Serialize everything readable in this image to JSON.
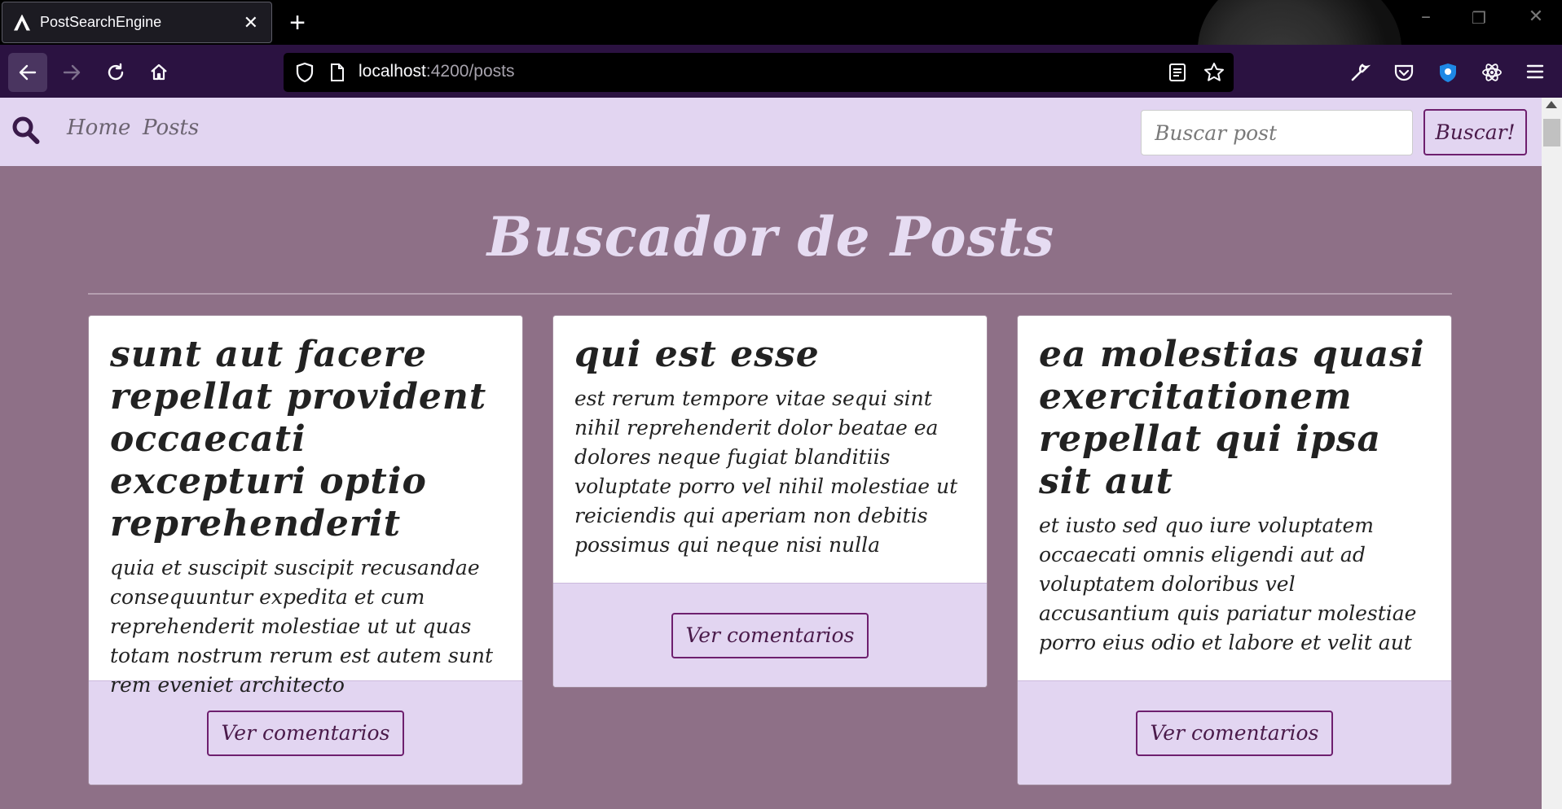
{
  "browser": {
    "tab_title": "PostSearchEngine",
    "tab_close": "✕",
    "new_tab": "+",
    "url_host": "localhost",
    "url_path": ":4200/posts",
    "win_min": "–",
    "win_restore": "❐",
    "win_close": "✕"
  },
  "navbar": {
    "links": [
      "Home",
      "Posts"
    ],
    "search_placeholder": "Buscar post",
    "search_button": "Buscar!"
  },
  "main": {
    "title": "Buscador de Posts",
    "posts": [
      {
        "title": "sunt aut facere repellat provident occaecati excepturi optio reprehenderit",
        "body": "quia et suscipit suscipit recusandae consequuntur expedita et cum reprehenderit molestiae ut ut quas totam nostrum rerum est autem sunt rem eveniet architecto",
        "button": "Ver comentarios"
      },
      {
        "title": "qui est esse",
        "body": "est rerum tempore vitae sequi sint nihil reprehenderit dolor beatae ea dolores neque fugiat blanditiis voluptate porro vel nihil molestiae ut reiciendis qui aperiam non debitis possimus qui neque nisi nulla",
        "button": "Ver comentarios"
      },
      {
        "title": "ea molestias quasi exercitationem repellat qui ipsa sit aut",
        "body": "et iusto sed quo iure voluptatem occaecati omnis eligendi aut ad voluptatem doloribus vel accusantium quis pariatur molestiae porro eius odio et labore et velit aut",
        "button": "Ver comentarios"
      }
    ]
  },
  "colors": {
    "page_bg": "#8e7087",
    "nav_bg": "#e2d5f1",
    "accent": "#6e1f6e",
    "browser_toolbar": "#2b1241"
  }
}
